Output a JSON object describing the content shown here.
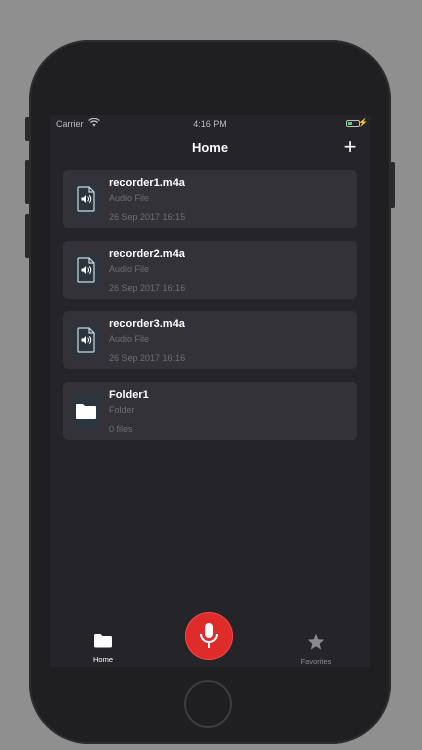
{
  "status_bar": {
    "carrier": "Carrier",
    "time": "4:16 PM",
    "battery_level": 0.35
  },
  "navbar": {
    "title": "Home",
    "add_label": "+"
  },
  "items": [
    {
      "name": "recorder1.m4a",
      "type": "Audio File",
      "meta": "26 Sep 2017 16:15",
      "icon": "audio-file-icon"
    },
    {
      "name": "recorder2.m4a",
      "type": "Audio File",
      "meta": "26 Sep 2017 16:16",
      "icon": "audio-file-icon"
    },
    {
      "name": "recorder3.m4a",
      "type": "Audio File",
      "meta": "26 Sep 2017 16:16",
      "icon": "audio-file-icon"
    },
    {
      "name": "Folder1",
      "type": "Folder",
      "meta": "0 files",
      "icon": "folder-icon"
    }
  ],
  "tabbar": {
    "home_label": "Home",
    "favorites_label": "Favorites",
    "record_icon": "microphone-icon"
  },
  "colors": {
    "background": "#252529",
    "card": "#323238",
    "record": "#e02b2b",
    "battery": "#4cd964"
  }
}
